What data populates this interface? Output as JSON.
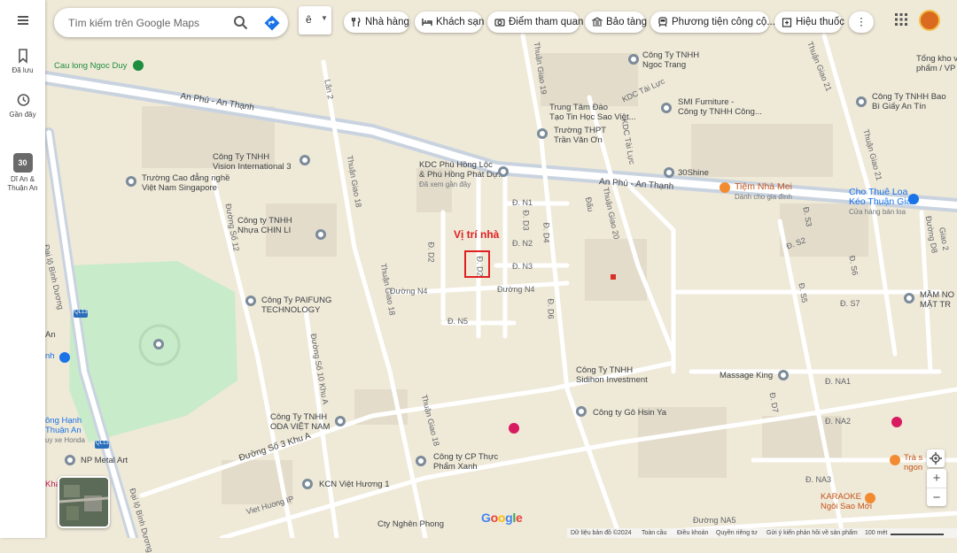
{
  "sidebar": {
    "items": [
      {
        "label": "Đã lưu",
        "icon": "bookmark-icon"
      },
      {
        "label": "Gần đây",
        "icon": "history-icon"
      },
      {
        "label": "Dĩ An & Thuận An",
        "line1": "Dĩ An &",
        "line2": "Thuận An",
        "icon": "area-thumbnail-icon",
        "badge": "30"
      }
    ]
  },
  "search": {
    "placeholder": "Tìm kiếm trên Google Maps",
    "value": ""
  },
  "language_selector": {
    "value": "ê"
  },
  "category_chips": [
    {
      "label": "Nhà hàng",
      "icon": "restaurant-icon"
    },
    {
      "label": "Khách sạn",
      "icon": "hotel-icon"
    },
    {
      "label": "Điểm tham quan",
      "icon": "camera-icon"
    },
    {
      "label": "Bảo tàng",
      "icon": "museum-icon"
    },
    {
      "label": "Phương tiện công cộ...",
      "icon": "transit-icon"
    },
    {
      "label": "Hiệu thuốc",
      "icon": "pharmacy-icon"
    }
  ],
  "more_chips": "⋮",
  "map": {
    "annotation": "Vị trí nhà",
    "places": [
      {
        "name": "Cau long Ngoc Duy"
      },
      {
        "name": "Công Ty TNHH",
        "name2": "Ngoc Trang"
      },
      {
        "name": "Trung Tâm Đào",
        "name2": "Tạo Tin Học Sao Việt..."
      },
      {
        "name": "SMI Furniture -",
        "name2": "Công ty TNHH Công..."
      },
      {
        "name": "Trường THPT",
        "name2": "Trần Văn Ơn"
      },
      {
        "name": "Công Ty TNHH Bao",
        "name2": "Bì Giấy An Tín"
      },
      {
        "name": "Tổng kho vì",
        "name2": "phẩm / VP"
      },
      {
        "name": "Công Ty TNHH",
        "name2": "Vision International 3"
      },
      {
        "name": "Trường Cao đẳng nghề",
        "name2": "Việt Nam Singapore"
      },
      {
        "name": "KDC Phú Hồng Lộc",
        "name2": "& Phú Hồng Phát Dự...",
        "name3": "Đã xem gần đây"
      },
      {
        "name": "30Shine"
      },
      {
        "name": "Tiệm Nhà Mei",
        "name2": "Dành cho gia đình"
      },
      {
        "name": "Cho Thuê Loa",
        "name2": "Kéo Thuận Giao",
        "name3": "Cửa hàng bán loa"
      },
      {
        "name": "Công ty TNHH",
        "name2": "Nhựa CHIN LI"
      },
      {
        "name": "Công Ty PAIFUNG",
        "name2": "TECHNOLOGY"
      },
      {
        "name": "MẦM NO",
        "name2": "MẶT TR"
      },
      {
        "name": "Công Ty TNHH",
        "name2": "Sidihon Investment"
      },
      {
        "name": "Massage King"
      },
      {
        "name": "Công ty Gô Hsin Ya"
      },
      {
        "name": "Công Ty TNHH",
        "name2": "ODA VIỆT NAM"
      },
      {
        "name": "Công ty CP Thực",
        "name2": "Phẩm Xanh"
      },
      {
        "name": "NP Metal Art"
      },
      {
        "name": "KCN Việt Hương 1"
      },
      {
        "name": "Cty Nghên Phong"
      },
      {
        "name": "KARAOKE",
        "name2": "Ngôi Sao Mới"
      },
      {
        "name": "Trà s",
        "name2": "ngon"
      },
      {
        "name": "ông Hạnh",
        "name2": "Thuận An",
        "name3": "uy xe Honda"
      },
      {
        "name": "An"
      },
      {
        "name": "nh"
      },
      {
        "name": "Khá"
      }
    ],
    "roads": [
      "An Phú - An Thạnh",
      "Lân 2",
      "Thuận Giao 19",
      "Thuận Giao 18",
      "Thuận Giao 20",
      "Thuận Giao 21",
      "KDC Tài Lực",
      "Đường Số 12",
      "Đường Số 10 Khu A",
      "Đường Số 3 Khu A",
      "Viet Huong IP",
      "Đại lộ Bình Dương",
      "Đ. N1",
      "Đ. N2",
      "Đ. N3",
      "Đ. N5",
      "Đường N4",
      "Đ. D2",
      "Đ. D3",
      "Đ. D4",
      "Đ. D6",
      "Đấu",
      "Đ. D7",
      "Đ. NA1",
      "Đ. NA2",
      "Đ. NA3",
      "Đường NA5",
      "Đ. S5",
      "Đ. S6",
      "Đ. S3",
      "Đ. S7",
      "Đ. S2",
      "Đường D8",
      "QL13",
      "Giao 2",
      "Đường NA5"
    ]
  },
  "controls": {
    "zoom_in": "+",
    "zoom_out": "−"
  },
  "footer": {
    "map_data": "Dữ liệu bản đồ ©2024",
    "global": "Toàn cầu",
    "terms": "Điều khoản",
    "privacy": "Quyền riêng tư",
    "feedback": "Gửi ý kiến phản hồi về sản phẩm",
    "scale": "100 mét"
  },
  "logo": "Google",
  "colors": {
    "land": "#efe9d8",
    "road": "#ffffff",
    "major_road": "#c9d3df",
    "park": "#c8ebc9",
    "building": "#e3dccb",
    "annotation_red": "#e02020"
  }
}
